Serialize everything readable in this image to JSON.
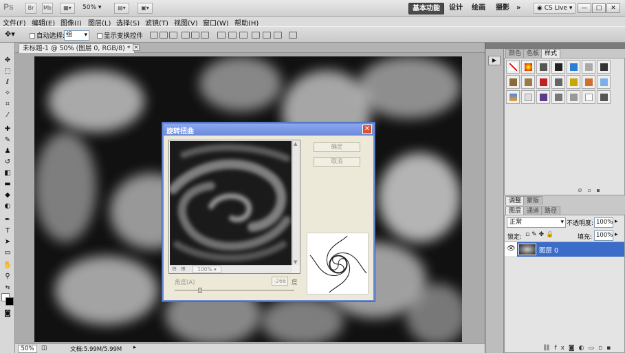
{
  "app": {
    "logo": "Ps",
    "zoom": "50%",
    "br_label": "Br",
    "mb_label": "Mb"
  },
  "workspaces": [
    "基本功能",
    "设计",
    "绘画",
    "摄影"
  ],
  "more_label": "»",
  "cslive": "CS Live",
  "window_controls": [
    "—",
    "□",
    "✕"
  ],
  "menu": [
    "文件(F)",
    "编辑(E)",
    "图像(I)",
    "图层(L)",
    "选择(S)",
    "滤镜(T)",
    "视图(V)",
    "窗口(W)",
    "帮助(H)"
  ],
  "options": {
    "auto_select_label": "自动选择:",
    "auto_select_value": "组",
    "show_transform_label": "显示变换控件"
  },
  "document": {
    "tab_title": "未标题-1 @ 50% (图层 0, RGB/8) *",
    "close": "×"
  },
  "status": {
    "zoom": "50%",
    "doc_info": "文档:5.99M/5.99M"
  },
  "panels": {
    "top_tabs": [
      "颜色",
      "色板",
      "样式"
    ],
    "mid_tabs": [
      "调整",
      "蒙版"
    ],
    "layer_tabs": [
      "图层",
      "通道",
      "路径"
    ],
    "blend_mode": "正常",
    "opacity_label": "不透明度:",
    "opacity_value": "100%",
    "lock_label": "锁定:",
    "fill_label": "填充:",
    "fill_value": "100%",
    "layer_name": "图层 0"
  },
  "dialog": {
    "title": "旋转扭曲",
    "ok": "确定",
    "cancel": "取消",
    "preview_zoom": "100%",
    "angle_label": "角度(A)",
    "angle_value": "-266",
    "angle_unit": "度",
    "angle_slider_fraction": 0.2
  },
  "colors": {
    "accent": "#4b4b4b",
    "dialog_title": "#6b89d8",
    "layer_selected": "#3a6cc8"
  }
}
